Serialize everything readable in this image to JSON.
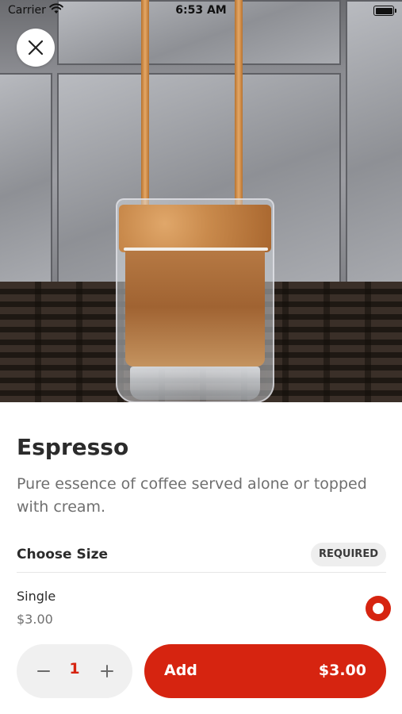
{
  "status_bar": {
    "carrier": "Carrier",
    "time": "6:53 AM"
  },
  "icons": {
    "wifi": "wifi-icon",
    "battery": "battery-icon",
    "close": "close-icon",
    "minus": "minus-icon",
    "plus": "plus-icon",
    "radio": "radio-selected-icon"
  },
  "product": {
    "name": "Espresso",
    "description": "Pure essence of coffee served alone or topped with cream."
  },
  "size_section": {
    "label": "Choose Size",
    "badge": "REQUIRED",
    "options": [
      {
        "name": "Single",
        "price": "$3.00",
        "selected": true
      }
    ]
  },
  "order": {
    "quantity": "1",
    "minus_symbol": "−",
    "plus_symbol": "+",
    "add_label": "Add",
    "total": "$3.00"
  },
  "colors": {
    "accent": "#d62410",
    "stepper_bg": "#f0f0f0",
    "badge_bg": "#eeeeee"
  }
}
